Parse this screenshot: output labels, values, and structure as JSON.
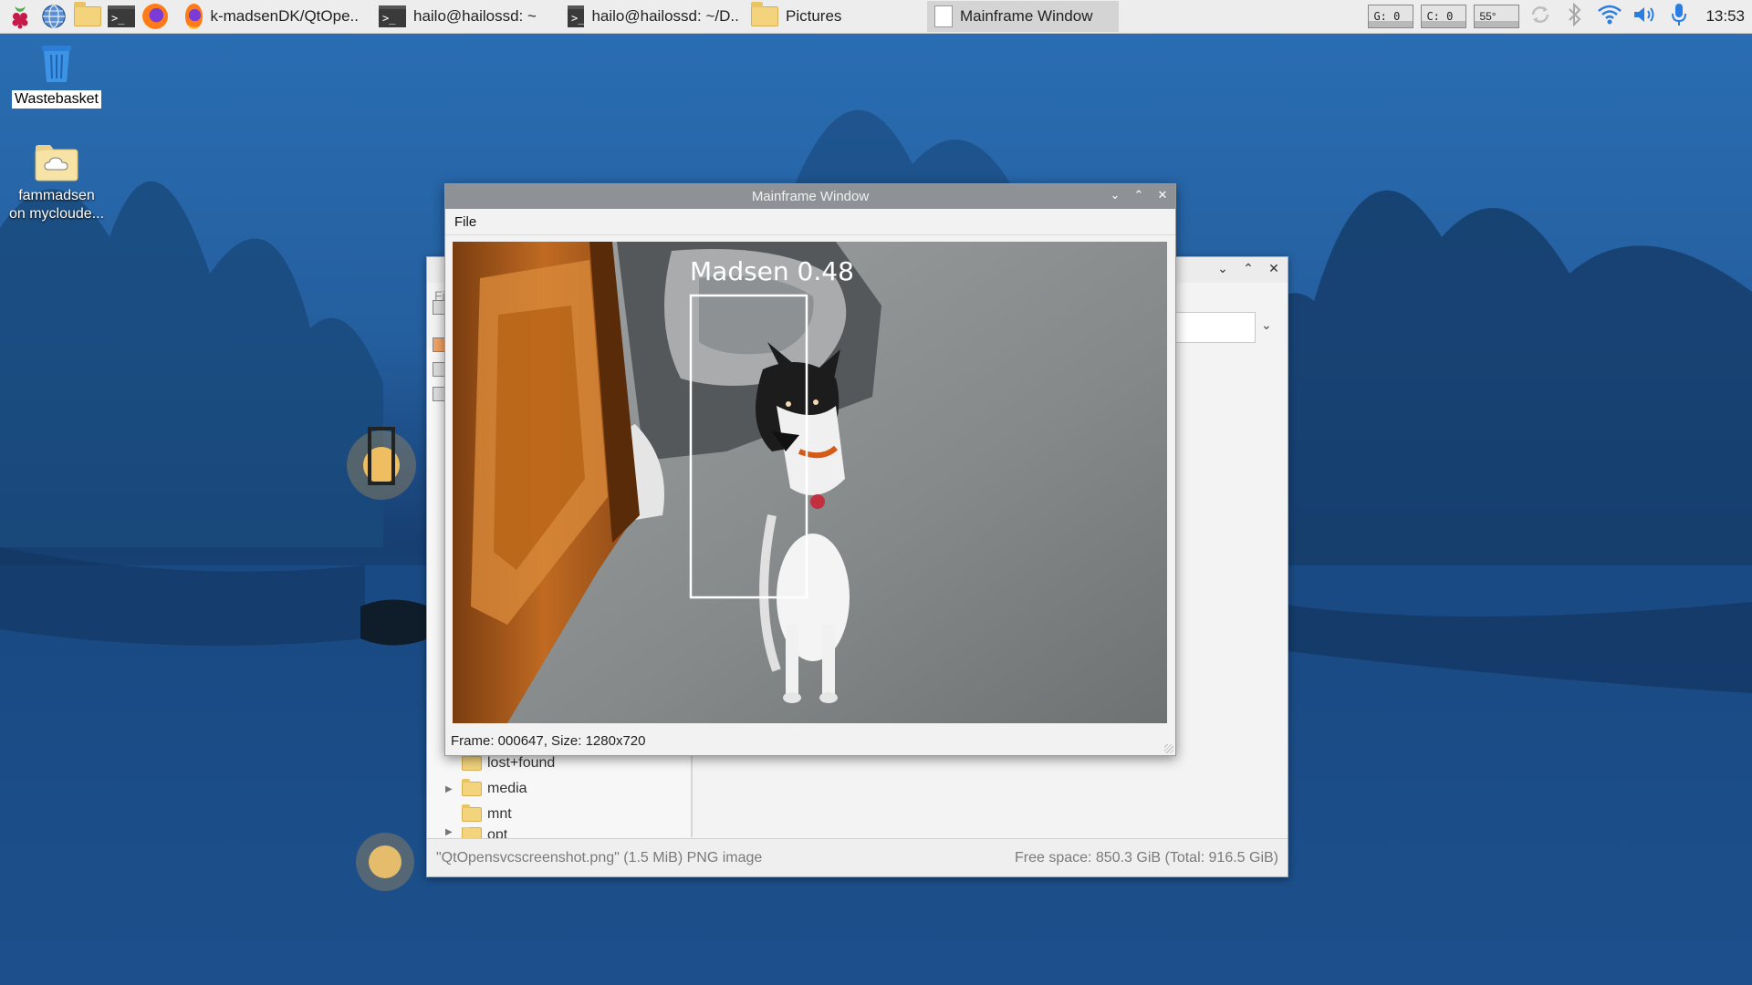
{
  "taskbar": {
    "tasks": [
      {
        "label": "k-madsenDK/QtOpe..",
        "icon": "firefox-icon"
      },
      {
        "label": "hailo@hailossd: ~",
        "icon": "terminal-icon"
      },
      {
        "label": "hailo@hailossd: ~/D..",
        "icon": "terminal-icon"
      },
      {
        "label": "Pictures",
        "icon": "folder-icon"
      },
      {
        "label": "Mainframe Window",
        "icon": "window-icon"
      }
    ],
    "monitors": {
      "gpu": "G:  0",
      "cpu": "C:  0",
      "temp": "55°"
    },
    "clock": "13:53",
    "terminal_glyph": ">_"
  },
  "desktop": {
    "wastebasket": "Wastebasket",
    "cloud_line1": "fammadsen",
    "cloud_line2": "on mycloude..."
  },
  "file_manager": {
    "sidebar_fragment": "Fi",
    "tree": [
      "lost+found",
      "media",
      "mnt",
      "opt"
    ],
    "status_left": "\"QtOpensvcscreenshot.png\" (1.5 MiB) PNG image",
    "status_right": "Free space: 850.3 GiB (Total: 916.5 GiB)"
  },
  "mainframe": {
    "title": "Mainframe Window",
    "menu_file": "File",
    "detection_label": "Madsen  0.48",
    "status": "Frame: 000647, Size: 1280x720"
  },
  "colors": {
    "titlebar": "#8e9296",
    "taskbar": "#ededed",
    "desktop_sky": "#1f4f8a"
  }
}
